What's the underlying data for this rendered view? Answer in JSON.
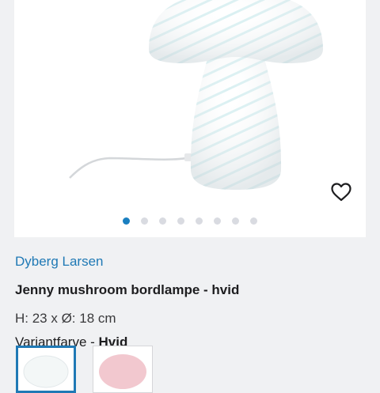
{
  "product": {
    "brand": "Dyberg Larsen",
    "title": "Jenny mushroom bordlampe - hvid",
    "dimensions": "H: 23 x Ø: 18 cm",
    "variant_label": "Variantfarve - ",
    "variant_value": "Hvid"
  },
  "gallery": {
    "image_count": 8,
    "active_index": 0
  },
  "colors": {
    "accent": "#1f79b5",
    "active_dot": "#1a7fc0",
    "swatch_pink": "#f2c8cf"
  },
  "icons": {
    "favorite": "heart-outline-icon"
  }
}
